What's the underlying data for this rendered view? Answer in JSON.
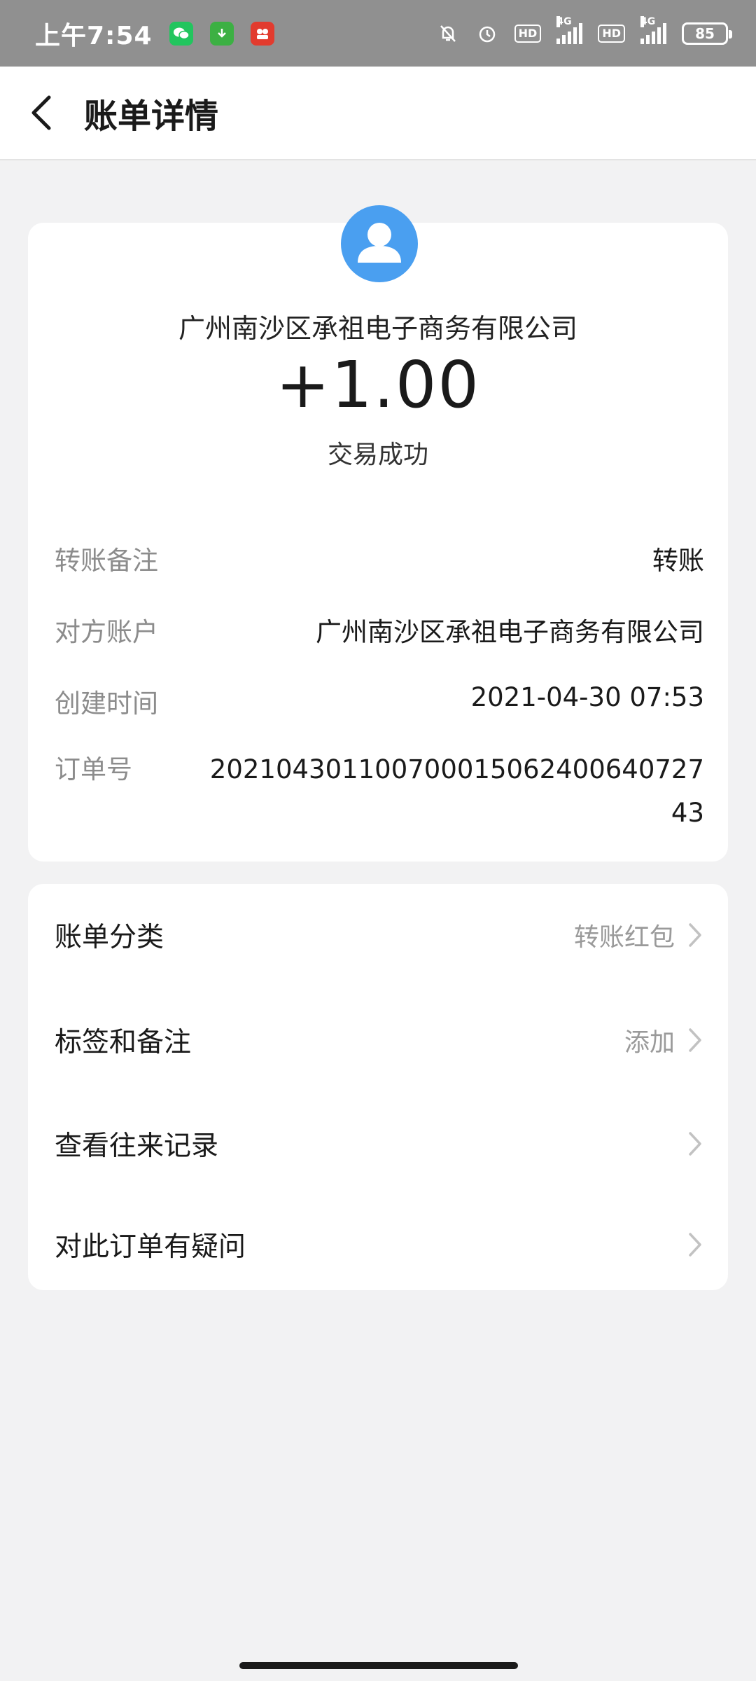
{
  "status_bar": {
    "time": "上午7:54",
    "battery": "85",
    "network_label_1": "4G",
    "network_label_2": "4G",
    "hd_1": "HD",
    "hd_2": "HD",
    "icons": [
      "wechat-icon",
      "download-icon",
      "video-app-icon",
      "mute-bell-icon",
      "alarm-icon",
      "signal-icon",
      "battery-icon"
    ]
  },
  "header": {
    "title": "账单详情"
  },
  "transaction": {
    "merchant": "广州南沙区承祖电子商务有限公司",
    "amount": "+1.00",
    "status": "交易成功"
  },
  "details": [
    {
      "label": "转账备注",
      "value": "转账"
    },
    {
      "label": "对方账户",
      "value": "广州南沙区承祖电子商务有限公司"
    },
    {
      "label": "创建时间",
      "value": "2021-04-30 07:53"
    },
    {
      "label": "订单号",
      "value": "20210430110070001506240064072743"
    }
  ],
  "menu": [
    {
      "label": "账单分类",
      "value": "转账红包"
    },
    {
      "label": "标签和备注",
      "value": "添加"
    },
    {
      "label": "查看往来记录",
      "value": ""
    },
    {
      "label": "对此订单有疑问",
      "value": ""
    }
  ],
  "colors": {
    "accent_avatar": "#4a9ff0",
    "status_bar": "#909090",
    "background": "#f2f2f3"
  }
}
